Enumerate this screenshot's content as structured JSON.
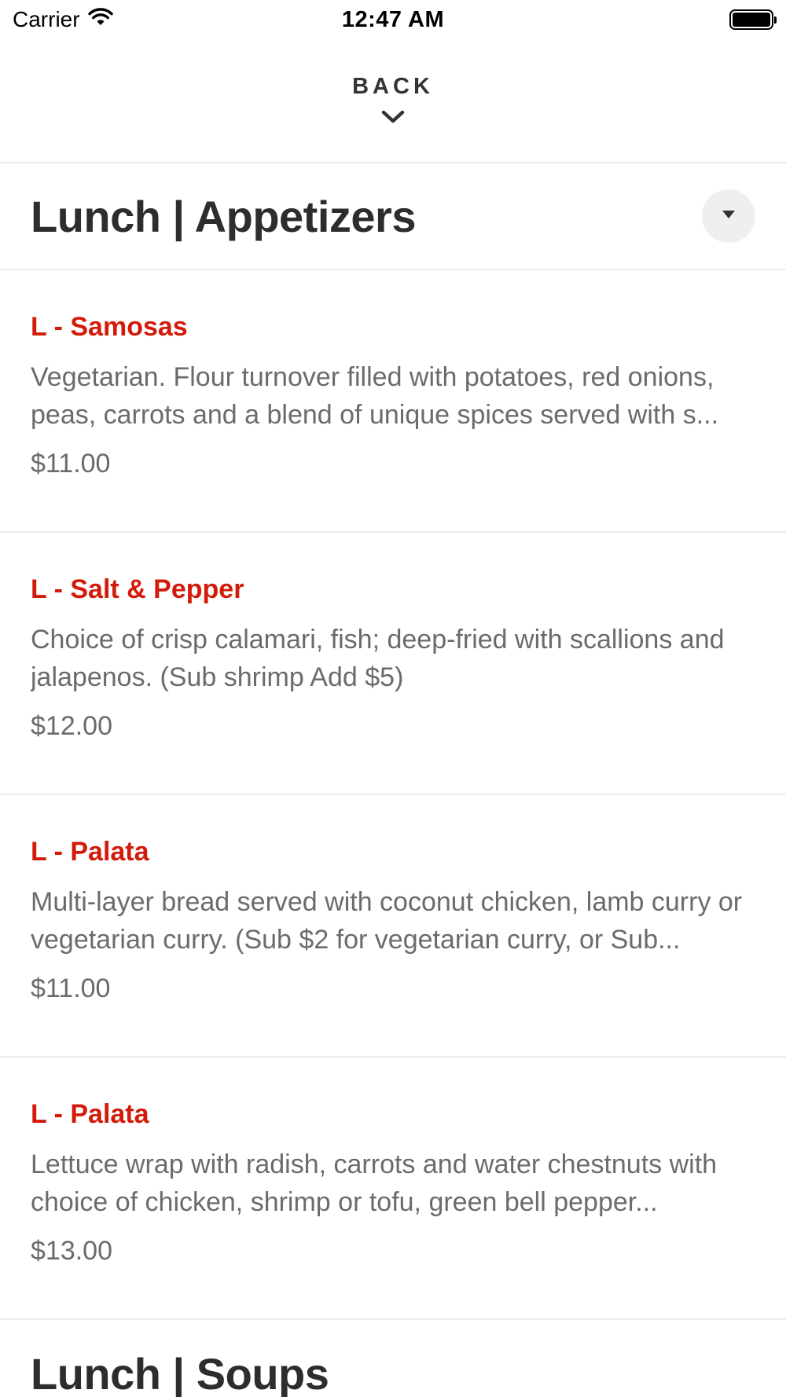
{
  "status_bar": {
    "carrier": "Carrier",
    "time": "12:47 AM"
  },
  "header": {
    "back_label": "BACK"
  },
  "sections": [
    {
      "title": "Lunch | Appetizers",
      "items": [
        {
          "name": "L - Samosas",
          "description": "Vegetarian. Flour turnover filled with potatoes, red onions, peas, carrots and a blend of unique spices served with s...",
          "price": "$11.00"
        },
        {
          "name": "L - Salt & Pepper",
          "description": "Choice of crisp calamari, fish; deep-fried with scallions and jalapenos. (Sub shrimp Add $5)",
          "price": "$12.00"
        },
        {
          "name": "L - Palata",
          "description": "Multi-layer bread served with coconut chicken, lamb curry or vegetarian curry. (Sub $2 for vegetarian curry, or Sub...",
          "price": "$11.00"
        },
        {
          "name": "L - Palata",
          "description": "Lettuce wrap with radish, carrots and water chestnuts with choice of chicken, shrimp or tofu, green bell pepper...",
          "price": "$13.00"
        }
      ]
    },
    {
      "title": "Lunch | Soups"
    }
  ],
  "colors": {
    "item_name": "#d21b0a",
    "text_muted": "#6b6b6b",
    "title": "#2d2d2d"
  }
}
